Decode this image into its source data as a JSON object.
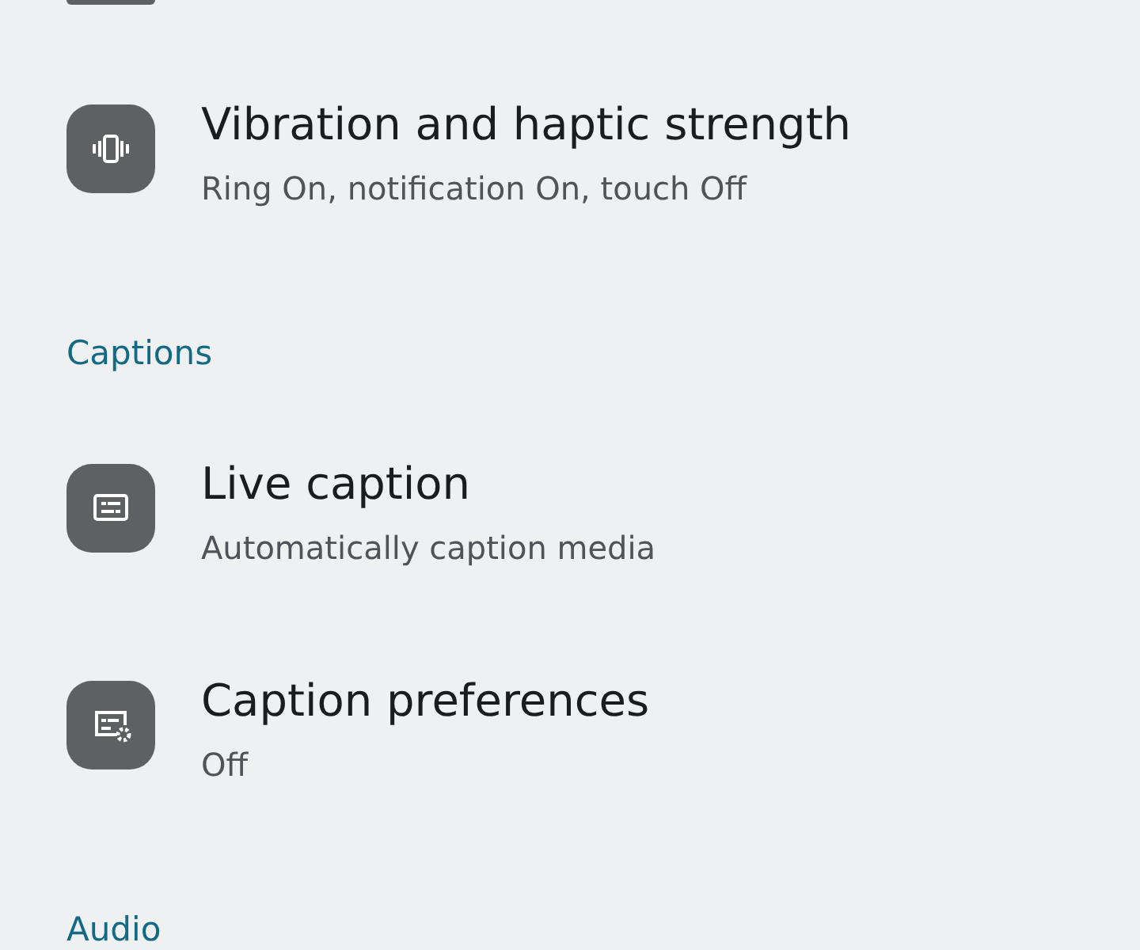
{
  "rows": [
    {
      "kind": "cut_icon"
    },
    {
      "kind": "item",
      "title": "Vibration and haptic strength",
      "summary": "Ring On, notification On, touch Off"
    },
    {
      "kind": "header",
      "title": "Captions"
    },
    {
      "kind": "item",
      "title": "Live caption",
      "summary": "Automatically caption media"
    },
    {
      "kind": "item",
      "title": "Caption preferences",
      "summary": "Off"
    },
    {
      "kind": "header",
      "title": "Audio"
    }
  ]
}
